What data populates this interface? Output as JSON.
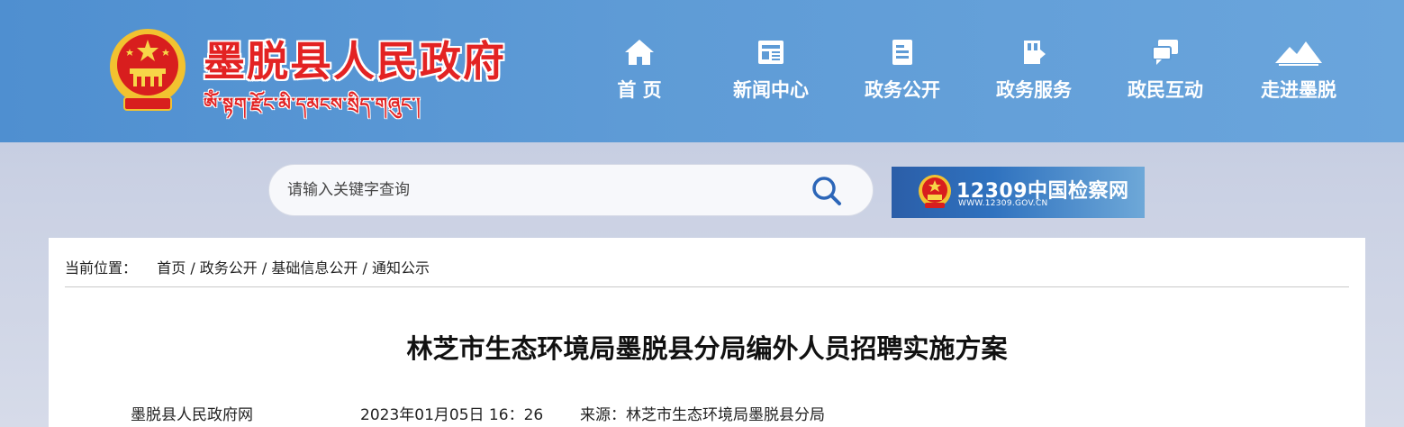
{
  "header": {
    "title": "墨脱县人民政府",
    "subtitle": "ༀ་སྟག་རྫོང་མི་དམངས་སྲིད་གཞུང་།",
    "nav": [
      {
        "label": "首 页",
        "icon": "home-icon"
      },
      {
        "label": "新闻中心",
        "icon": "news-icon"
      },
      {
        "label": "政务公开",
        "icon": "document-icon"
      },
      {
        "label": "政务服务",
        "icon": "service-icon"
      },
      {
        "label": "政民互动",
        "icon": "chat-icon"
      },
      {
        "label": "走进墨脱",
        "icon": "mountain-icon"
      }
    ]
  },
  "search": {
    "placeholder": "请输入关键字查询",
    "icon": "search-icon"
  },
  "banner": {
    "title": "12309中国检察网",
    "url": "WWW.12309.GOV.CN"
  },
  "breadcrumb": {
    "prefix": "当前位置：",
    "items": [
      "首页",
      "政务公开",
      "基础信息公开",
      "通知公示"
    ],
    "separator": " / "
  },
  "article": {
    "title": "林芝市生态环境局墨脱县分局编外人员招聘实施方案",
    "publisher": "墨脱县人民政府网",
    "datetime": "2023年01月05日 16：26",
    "source": "来源：林芝市生态环境局墨脱县分局"
  },
  "colors": {
    "header_bg": "#5e9bd6",
    "title_red": "#e32323",
    "panel_bg": "#ffffff"
  }
}
